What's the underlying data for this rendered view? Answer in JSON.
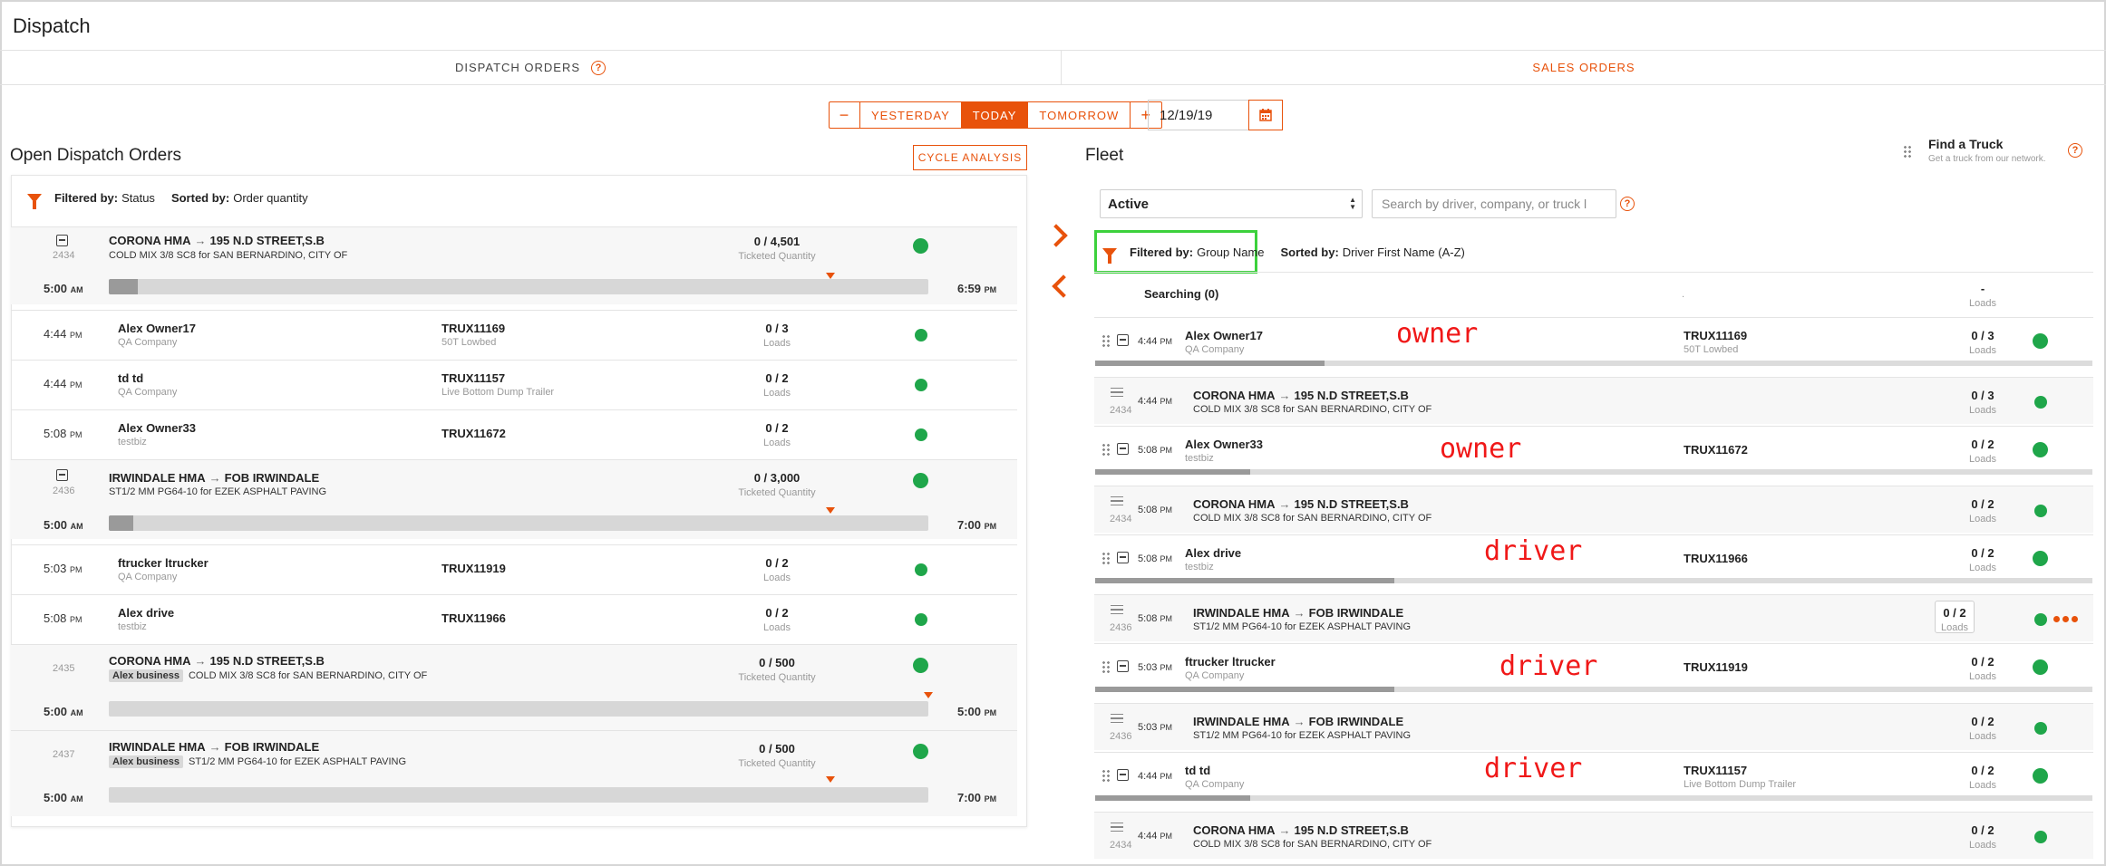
{
  "app": {
    "title": "Dispatch"
  },
  "tabs": [
    {
      "label": "DISPATCH ORDERS"
    },
    {
      "label": "SALES ORDERS"
    }
  ],
  "date_nav": {
    "minus": "−",
    "plus": "+",
    "yesterday": "YESTERDAY",
    "today": "TODAY",
    "tomorrow": "TOMORROW",
    "selected": "TODAY",
    "date_value": "12/19/19"
  },
  "help_glyph": "?",
  "arrow_glyph": "→",
  "left": {
    "title": "Open Dispatch Orders",
    "cycle_button": "CYCLE ANALYSIS",
    "filter_label": "Filtered by:",
    "filter_value": "Status",
    "sort_label": "Sorted by:",
    "sort_value": "Order quantity",
    "orders": [
      {
        "number": "2434",
        "from": "CORONA HMA",
        "to": "195 N.D STREET,S.B",
        "business": "",
        "desc": "COLD MIX 3/8 SC8 for SAN BERNARDINO, CITY OF",
        "qty": "0 / 4,501",
        "qty_label": "Ticketed Quantity",
        "start": "5:00",
        "start_ampm": "AM",
        "end": "6:59",
        "end_ampm": "PM",
        "progress": 0.035,
        "marker": 0.88
      },
      {
        "number": "2436",
        "from": "IRWINDALE HMA",
        "to": "FOB IRWINDALE",
        "business": "",
        "desc": "ST1/2 MM PG64-10 for EZEK ASPHALT PAVING",
        "qty": "0 / 3,000",
        "qty_label": "Ticketed Quantity",
        "start": "5:00",
        "start_ampm": "AM",
        "end": "7:00",
        "end_ampm": "PM",
        "progress": 0.03,
        "marker": 0.88
      },
      {
        "number": "2435",
        "from": "CORONA HMA",
        "to": "195 N.D STREET,S.B",
        "business": "Alex business",
        "desc": "COLD MIX 3/8 SC8 for SAN BERNARDINO, CITY OF",
        "qty": "0 / 500",
        "qty_label": "Ticketed Quantity",
        "start": "5:00",
        "start_ampm": "AM",
        "end": "5:00",
        "end_ampm": "PM",
        "progress": 0,
        "marker": 1.0
      },
      {
        "number": "2437",
        "from": "IRWINDALE HMA",
        "to": "FOB IRWINDALE",
        "business": "Alex business",
        "desc": "ST1/2 MM PG64-10 for EZEK ASPHALT PAVING",
        "qty": "0 / 500",
        "qty_label": "Ticketed Quantity",
        "start": "5:00",
        "start_ampm": "AM",
        "end": "7:00",
        "end_ampm": "PM",
        "progress": 0,
        "marker": 0.88
      }
    ],
    "assignments": [
      {
        "time": "4:44",
        "ampm": "PM",
        "name": "Alex Owner17",
        "company": "QA Company",
        "truck": "TRUX11169",
        "truck_type": "50T Lowbed",
        "loads": "0 / 3",
        "loads_label": "Loads"
      },
      {
        "time": "4:44",
        "ampm": "PM",
        "name": "td td",
        "company": "QA Company",
        "truck": "TRUX11157",
        "truck_type": "Live Bottom Dump Trailer",
        "loads": "0 / 2",
        "loads_label": "Loads"
      },
      {
        "time": "5:08",
        "ampm": "PM",
        "name": "Alex Owner33",
        "company": "testbiz",
        "truck": "TRUX11672",
        "truck_type": "",
        "loads": "0 / 2",
        "loads_label": "Loads"
      },
      {
        "time": "5:03",
        "ampm": "PM",
        "name": "ftrucker ltrucker",
        "company": "QA Company",
        "truck": "TRUX11919",
        "truck_type": "",
        "loads": "0 / 2",
        "loads_label": "Loads"
      },
      {
        "time": "5:08",
        "ampm": "PM",
        "name": "Alex drive",
        "company": "testbiz",
        "truck": "TRUX11966",
        "truck_type": "",
        "loads": "0 / 2",
        "loads_label": "Loads"
      }
    ]
  },
  "fleet": {
    "title": "Fleet",
    "find_truck_title": "Find a Truck",
    "find_truck_sub": "Get a truck from our network.",
    "status_select": "Active",
    "search_placeholder": "Search by driver, company, or truck l",
    "filter_label": "Filtered by:",
    "filter_value": "Group Name",
    "sort_label": "Sorted by:",
    "sort_value": "Driver First Name (A-Z)",
    "searching": "Searching (0)",
    "searching_dot": ".",
    "searching_loads": "-",
    "searching_loads_label": "Loads",
    "groups": [
      {
        "time": "4:44",
        "ampm": "PM",
        "name": "Alex Owner17",
        "company": "QA Company",
        "annotation": "owner",
        "truck": "TRUX11169",
        "truck_type": "50T Lowbed",
        "loads": "0 / 3",
        "loads_label": "Loads",
        "progress": 0.23,
        "orders": [
          {
            "number": "2434",
            "time": "4:44",
            "ampm": "PM",
            "from": "CORONA HMA",
            "to": "195 N.D STREET,S.B",
            "desc": "COLD MIX 3/8 SC8 for SAN BERNARDINO, CITY OF",
            "loads": "0 / 3",
            "loads_label": "Loads"
          }
        ]
      },
      {
        "time": "5:08",
        "ampm": "PM",
        "name": "Alex Owner33",
        "company": "testbiz",
        "annotation": "owner",
        "truck": "TRUX11672",
        "truck_type": "",
        "loads": "0 / 2",
        "loads_label": "Loads",
        "progress": 0.155,
        "orders": [
          {
            "number": "2434",
            "time": "5:08",
            "ampm": "PM",
            "from": "CORONA HMA",
            "to": "195 N.D STREET,S.B",
            "desc": "COLD MIX 3/8 SC8 for SAN BERNARDINO, CITY OF",
            "loads": "0 / 2",
            "loads_label": "Loads"
          }
        ]
      },
      {
        "time": "5:08",
        "ampm": "PM",
        "name": "Alex drive",
        "company": "testbiz",
        "annotation": "driver",
        "truck": "TRUX11966",
        "truck_type": "",
        "loads": "0 / 2",
        "loads_label": "Loads",
        "progress": 0.3,
        "orders": [
          {
            "number": "2436",
            "time": "5:08",
            "ampm": "PM",
            "from": "IRWINDALE HMA",
            "to": "FOB IRWINDALE",
            "desc": "ST1/2 MM PG64-10 for EZEK ASPHALT PAVING",
            "loads": "0 / 2",
            "loads_label": "Loads"
          }
        ]
      },
      {
        "time": "5:03",
        "ampm": "PM",
        "name": "ftrucker ltrucker",
        "company": "QA Company",
        "annotation": "driver",
        "truck": "TRUX11919",
        "truck_type": "",
        "loads": "0 / 2",
        "loads_label": "Loads",
        "progress": 0.3,
        "orders": [
          {
            "number": "2436",
            "time": "5:03",
            "ampm": "PM",
            "from": "IRWINDALE HMA",
            "to": "FOB IRWINDALE",
            "desc": "ST1/2 MM PG64-10 for EZEK ASPHALT PAVING",
            "loads": "0 / 2",
            "loads_label": "Loads"
          }
        ]
      },
      {
        "time": "4:44",
        "ampm": "PM",
        "name": "td td",
        "company": "QA Company",
        "annotation": "driver",
        "truck": "TRUX11157",
        "truck_type": "Live Bottom Dump Trailer",
        "loads": "0 / 2",
        "loads_label": "Loads",
        "progress": 0.155,
        "orders": [
          {
            "number": "2434",
            "time": "4:44",
            "ampm": "PM",
            "from": "CORONA HMA",
            "to": "195 N.D STREET,S.B",
            "desc": "COLD MIX 3/8 SC8 for SAN BERNARDINO, CITY OF",
            "loads": "0 / 2",
            "loads_label": "Loads"
          }
        ]
      }
    ]
  },
  "colors": {
    "accent": "#e8520b",
    "status_green": "#1fa64a",
    "annotation_red": "#f01818",
    "highlight_green": "#3cd13c"
  }
}
